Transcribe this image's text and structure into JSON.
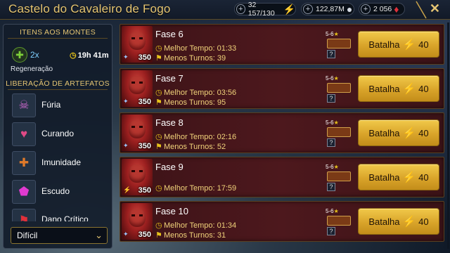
{
  "header": {
    "title": "Castelo do Cavaleiro de Fogo",
    "resources": [
      {
        "name": "energy",
        "value": "32 157/130",
        "icon": "lightning-icon",
        "color": "#f2d230"
      },
      {
        "name": "silver",
        "value": "122,87M",
        "icon": "silver-coin-icon",
        "color": "#d6dbe4"
      },
      {
        "name": "gems",
        "value": "2 056",
        "icon": "ruby-icon",
        "color": "#e0303a"
      }
    ],
    "close_icon": "close-icon"
  },
  "sidebar": {
    "mountains_title": "ITENS AOS MONTES",
    "regen_multiplier": "2x",
    "regen_time": "19h 41m",
    "regen_label": "Regeneração",
    "artifacts_title": "LIBERAÇÃO DE ARTEFATOS",
    "artifacts": [
      {
        "label": "Fúria",
        "icon": "skull-icon"
      },
      {
        "label": "Curando",
        "icon": "heart-icon"
      },
      {
        "label": "Imunidade",
        "icon": "shield-cross-icon"
      },
      {
        "label": "Escudo",
        "icon": "shield-icon"
      },
      {
        "label": "Dano Crítico",
        "icon": "axe-icon"
      }
    ],
    "difficulty": "Difícil"
  },
  "stages": [
    {
      "name": "Fase 6",
      "level": "350",
      "best_time_label": "Melhor Tempo:",
      "best_time": "01:33",
      "turns_label": "Menos Turnos:",
      "turns": "39",
      "loot_tag": "5-6",
      "button": "Batalha",
      "cost": "40"
    },
    {
      "name": "Fase 7",
      "level": "350",
      "best_time_label": "Melhor Tempo:",
      "best_time": "03:56",
      "turns_label": "Menos Turnos:",
      "turns": "95",
      "loot_tag": "5-6",
      "button": "Batalha",
      "cost": "40"
    },
    {
      "name": "Fase 8",
      "level": "350",
      "best_time_label": "Melhor Tempo:",
      "best_time": "02:16",
      "turns_label": "Menos Turnos:",
      "turns": "52",
      "loot_tag": "5-6",
      "button": "Batalha",
      "cost": "40"
    },
    {
      "name": "Fase 9",
      "level": "350",
      "best_time_label": "Melhor Tempo:",
      "best_time": "17:59",
      "turns_label": "",
      "turns": "",
      "loot_tag": "5-6",
      "button": "Batalha",
      "cost": "40"
    },
    {
      "name": "Fase 10",
      "level": "350",
      "best_time_label": "Melhor Tempo:",
      "best_time": "01:34",
      "turns_label": "Menos Turnos:",
      "turns": "31",
      "loot_tag": "5-6",
      "button": "Batalha",
      "cost": "40"
    }
  ],
  "colors": {
    "gold": "#e6c673",
    "stage_bg": "#4d181d",
    "button": "#d9a42a",
    "energy": "#6fd42c"
  }
}
